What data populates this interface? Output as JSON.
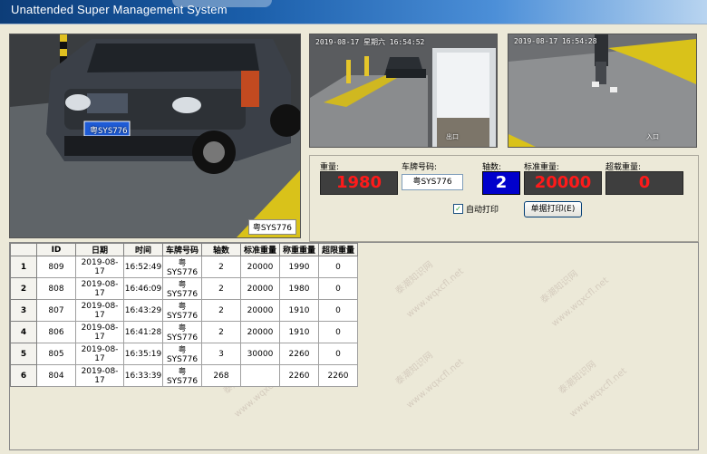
{
  "app": {
    "title": "Unattended Super Management System"
  },
  "cameras": {
    "main": {
      "plate_label": "粤SYS776",
      "vehicle_plate": "粤SYS776"
    },
    "cam2": {
      "timestamp": "2019-08-17 星期六 16:54:52",
      "sign_text": "出口"
    },
    "cam3": {
      "timestamp": "2019-08-17 16:54:28",
      "sign_text": "入口"
    }
  },
  "weighing": {
    "gross_label": "重量:",
    "gross_value": "1980",
    "plate_label": "车牌号码:",
    "plate_value": "粤SYS776",
    "axles_label": "轴数:",
    "axles_value": "2",
    "standard_label": "标准重量:",
    "standard_value": "20000",
    "overload_label": "超载重量:",
    "overload_value": "0",
    "auto_print_label": "自动打印",
    "auto_print_checked": true,
    "print_button": "单据打印(E)"
  },
  "table": {
    "headers": [
      "",
      "ID",
      "日期",
      "时间",
      "车牌号码",
      "轴数",
      "标准重量",
      "称重重量",
      "超限重量"
    ],
    "rows": [
      [
        "1",
        "809",
        "2019-08-17",
        "16:52:49",
        "粤SYS776",
        "2",
        "20000",
        "1990",
        "0"
      ],
      [
        "2",
        "808",
        "2019-08-17",
        "16:46:09",
        "粤SYS776",
        "2",
        "20000",
        "1980",
        "0"
      ],
      [
        "3",
        "807",
        "2019-08-17",
        "16:43:29",
        "粤SYS776",
        "2",
        "20000",
        "1910",
        "0"
      ],
      [
        "4",
        "806",
        "2019-08-17",
        "16:41:28",
        "粤SYS776",
        "2",
        "20000",
        "1910",
        "0"
      ],
      [
        "5",
        "805",
        "2019-08-17",
        "16:35:19",
        "粤SYS776",
        "3",
        "30000",
        "2260",
        "0"
      ],
      [
        "6",
        "804",
        "2019-08-17",
        "16:33:39",
        "粤SYS776",
        "268",
        "",
        "2260",
        "2260"
      ]
    ]
  },
  "watermark": {
    "text_cn": "泰潮知识网",
    "text_url": "www.wqxcfl.net"
  },
  "colors": {
    "led_bg": "#3e3e3e",
    "led_text": "#ff1a1a",
    "axle_bg": "#0000cc",
    "title_bar": "#1a5eaa"
  }
}
